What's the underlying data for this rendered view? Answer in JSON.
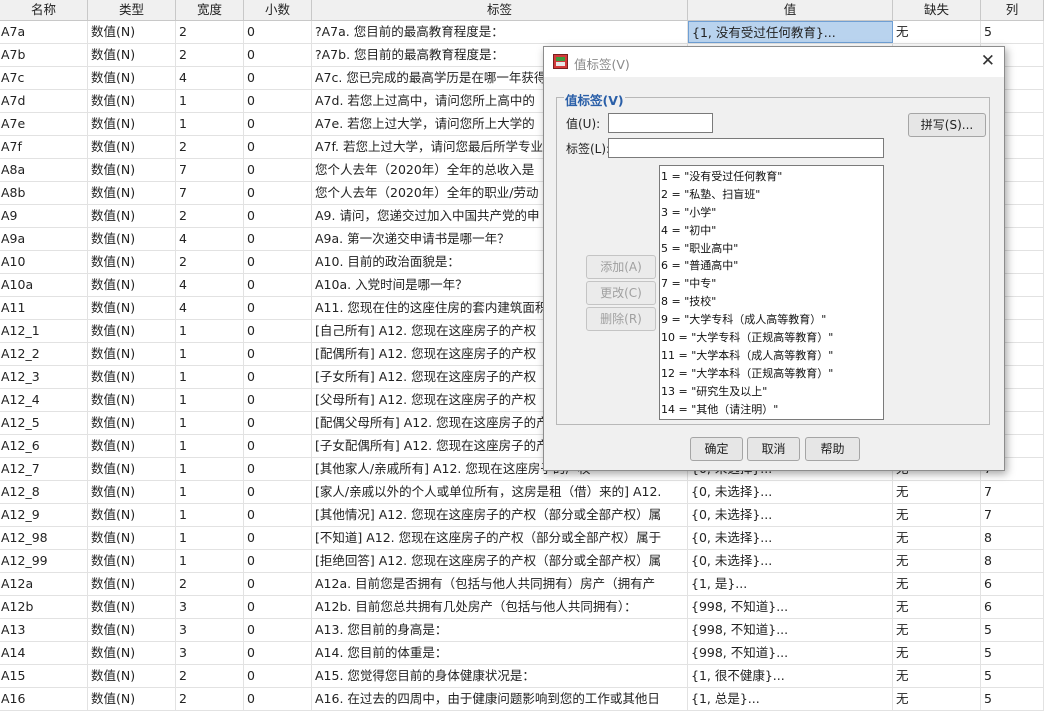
{
  "grid": {
    "headers": [
      "名称",
      "类型",
      "宽度",
      "小数",
      "标签",
      "值",
      "缺失",
      "列"
    ],
    "rows": [
      [
        "A7a",
        "数值(N)",
        "2",
        "0",
        "?A7a. 您目前的最高教育程度是：",
        "{1, 没有受过任何教育}...",
        "无",
        "5"
      ],
      [
        "A7b",
        "数值(N)",
        "2",
        "0",
        "?A7b. 您目前的最高教育程度是：",
        "",
        "",
        ""
      ],
      [
        "A7c",
        "数值(N)",
        "4",
        "0",
        "A7c. 您已完成的最高学历是在哪一年获得",
        "",
        "",
        ""
      ],
      [
        "A7d",
        "数值(N)",
        "1",
        "0",
        "A7d. 若您上过高中，请问您所上高中的",
        "",
        "",
        ""
      ],
      [
        "A7e",
        "数值(N)",
        "1",
        "0",
        "A7e. 若您上过大学，请问您所上大学的",
        "",
        "",
        ""
      ],
      [
        "A7f",
        "数值(N)",
        "2",
        "0",
        "A7f. 若您上过大学，请问您最后所学专业",
        "",
        "",
        ""
      ],
      [
        "A8a",
        "数值(N)",
        "7",
        "0",
        "您个人去年（2020年）全年的总收入是",
        "",
        "",
        ""
      ],
      [
        "A8b",
        "数值(N)",
        "7",
        "0",
        "您个人去年（2020年）全年的职业/劳动",
        "",
        "",
        ""
      ],
      [
        "A9",
        "数值(N)",
        "2",
        "0",
        "A9. 请问，您递交过加入中国共产党的申",
        "",
        "",
        ""
      ],
      [
        "A9a",
        "数值(N)",
        "4",
        "0",
        "A9a. 第一次递交申请书是哪一年？",
        "",
        "",
        ""
      ],
      [
        "A10",
        "数值(N)",
        "2",
        "0",
        "A10. 目前的政治面貌是：",
        "",
        "",
        ""
      ],
      [
        "A10a",
        "数值(N)",
        "4",
        "0",
        "A10a. 入党时间是哪一年？",
        "",
        "",
        ""
      ],
      [
        "A11",
        "数值(N)",
        "4",
        "0",
        "A11. 您现在住的这座住房的套内建筑面积",
        "",
        "",
        ""
      ],
      [
        "A12_1",
        "数值(N)",
        "1",
        "0",
        "[自己所有] A12. 您现在这座房子的产权",
        "",
        "",
        ""
      ],
      [
        "A12_2",
        "数值(N)",
        "1",
        "0",
        "[配偶所有] A12. 您现在这座房子的产权",
        "",
        "",
        ""
      ],
      [
        "A12_3",
        "数值(N)",
        "1",
        "0",
        "[子女所有] A12. 您现在这座房子的产权",
        "",
        "",
        ""
      ],
      [
        "A12_4",
        "数值(N)",
        "1",
        "0",
        "[父母所有] A12. 您现在这座房子的产权",
        "",
        "",
        ""
      ],
      [
        "A12_5",
        "数值(N)",
        "1",
        "0",
        "[配偶父母所有] A12. 您现在这座房子的产",
        "",
        "",
        ""
      ],
      [
        "A12_6",
        "数值(N)",
        "1",
        "0",
        "[子女配偶所有] A12. 您现在这座房子的产",
        "",
        "",
        ""
      ],
      [
        "A12_7",
        "数值(N)",
        "1",
        "0",
        "[其他家人/亲戚所有] A12. 您现在这座房子的产权",
        "{0, 未选择}...",
        "无",
        "7"
      ],
      [
        "A12_8",
        "数值(N)",
        "1",
        "0",
        "[家人/亲戚以外的个人或单位所有，这房是租（借）来的] A12.",
        "{0, 未选择}...",
        "无",
        "7"
      ],
      [
        "A12_9",
        "数值(N)",
        "1",
        "0",
        "[其他情况] A12. 您现在这座房子的产权（部分或全部产权）属",
        "{0, 未选择}...",
        "无",
        "7"
      ],
      [
        "A12_98",
        "数值(N)",
        "1",
        "0",
        "[不知道] A12. 您现在这座房子的产权（部分或全部产权）属于",
        "{0, 未选择}...",
        "无",
        "8"
      ],
      [
        "A12_99",
        "数值(N)",
        "1",
        "0",
        "[拒绝回答] A12. 您现在这座房子的产权（部分或全部产权）属",
        "{0, 未选择}...",
        "无",
        "8"
      ],
      [
        "A12a",
        "数值(N)",
        "2",
        "0",
        "A12a. 目前您是否拥有（包括与他人共同拥有）房产（拥有产",
        "{1, 是}...",
        "无",
        "6"
      ],
      [
        "A12b",
        "数值(N)",
        "3",
        "0",
        "A12b. 目前您总共拥有几处房产（包括与他人共同拥有）：",
        "{998, 不知道}...",
        "无",
        "6"
      ],
      [
        "A13",
        "数值(N)",
        "3",
        "0",
        "A13. 您目前的身高是：",
        "{998, 不知道}...",
        "无",
        "5"
      ],
      [
        "A14",
        "数值(N)",
        "3",
        "0",
        "A14. 您目前的体重是：",
        "{998, 不知道}...",
        "无",
        "5"
      ],
      [
        "A15",
        "数值(N)",
        "2",
        "0",
        "A15. 您觉得您目前的身体健康状况是：",
        "{1, 很不健康}...",
        "无",
        "5"
      ],
      [
        "A16",
        "数值(N)",
        "2",
        "0",
        "A16. 在过去的四周中，由于健康问题影响到您的工作或其他日",
        "{1, 总是}...",
        "无",
        "5"
      ]
    ]
  },
  "dialog": {
    "title": "值标签(V)",
    "group_label": "值标签(V)",
    "value_label": "值(U):",
    "label_label": "标签(L):",
    "spell_button": "拼写(S)...",
    "add_button": "添加(A)",
    "change_button": "更改(C)",
    "delete_button": "删除(R)",
    "ok_button": "确定",
    "cancel_button": "取消",
    "help_button": "帮助",
    "value_input": "",
    "label_input": "",
    "list_items": [
      "1 = \"没有受过任何教育\"",
      "2 = \"私塾、扫盲班\"",
      "3 = \"小学\"",
      "4 = \"初中\"",
      "5 = \"职业高中\"",
      "6 = \"普通高中\"",
      "7 = \"中专\"",
      "8 = \"技校\"",
      "9 = \"大学专科（成人高等教育）\"",
      "10 = \"大学专科（正规高等教育）\"",
      "11 = \"大学本科（成人高等教育）\"",
      "12 = \"大学本科（正规高等教育）\"",
      "13 = \"研究生及以上\"",
      "14 = \"其他（请注明）\""
    ]
  },
  "colors": {
    "selected_cell": "#b9d3ee",
    "group_label": "#2a5fa8",
    "dialog_bg": "#f0f0f0"
  },
  "icons": {
    "dialog_icon": "value-labels-icon",
    "close": "close-icon"
  }
}
